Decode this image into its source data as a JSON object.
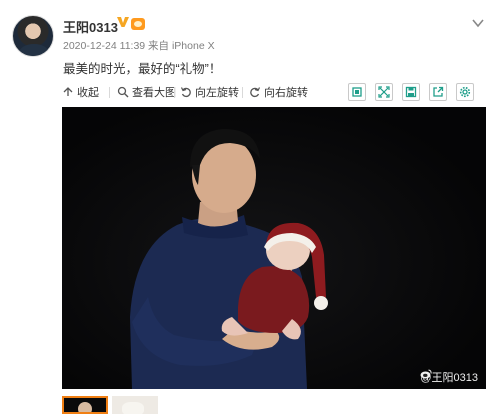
{
  "post": {
    "author": "王阳0313",
    "meta": "2020-12-24 11:39 来自 iPhone X",
    "text": "最美的时光，最好的“礼物”！"
  },
  "toolbar": {
    "collapse_label": "收起",
    "view_large_label": "查看大图",
    "rotate_left_label": "向左旋转",
    "rotate_right_label": "向右旋转",
    "icon_buttons": [
      "exit-fullscreen-icon",
      "fullscreen-icon",
      "save-icon",
      "share-icon",
      "settings-icon"
    ]
  },
  "photo": {
    "watermark": "@王阳0313"
  },
  "colors": {
    "accent": "#f07f13",
    "meta_gray": "#808080",
    "badge_gold": "#f5a623"
  }
}
